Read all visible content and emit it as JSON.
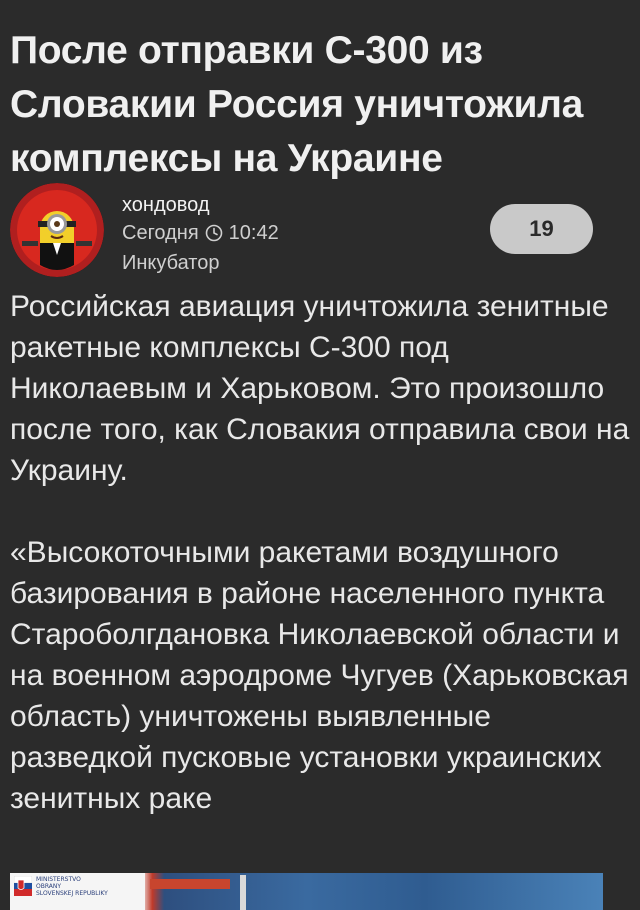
{
  "article": {
    "title_lines": [
      "После отправки С-300 из",
      "Словакии Россия уничтожила",
      "комплексы на Украине"
    ],
    "author": "хондовод",
    "date": "Сегодня",
    "time": "10:42",
    "community": "Инкубатор",
    "rating": "19",
    "paragraph1": "Российская авиация уничтожила зенитные ракетные комплексы С-300 под Николаевым и Харьковом. Это произошло после того, как Словакия отправила свои на Украину.",
    "paragraph2": "«Высокоточными ракетами воздушного базирования в районе населенного пункта Староболгдановка Николаевской области и на военном аэродроме Чугуев (Харьковская область) уничтожены выявленные разведкой пусковые установки украинских зенитных раке"
  },
  "image": {
    "ministry_lines": [
      "MINISTERSTVO",
      "OBRANY",
      "SLOVENSKEJ REPUBLIKY"
    ]
  },
  "colors": {
    "background": "#2b2b2b",
    "text": "#e8e8e8",
    "rating_badge": "#c9c9c9"
  },
  "icons": [
    "avatar-minion",
    "clock-icon",
    "slovak-flag-icon"
  ]
}
